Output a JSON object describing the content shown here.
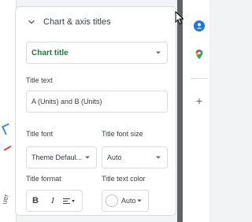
{
  "section": {
    "title": "Chart & axis titles"
  },
  "title_type": {
    "selected": "Chart title"
  },
  "title_text": {
    "label": "Title text",
    "value": "A (Units) and B (Units)"
  },
  "title_font": {
    "label": "Title font",
    "selected": "Theme Defaul..."
  },
  "title_font_size": {
    "label": "Title font size",
    "selected": "Auto"
  },
  "title_format": {
    "label": "Title format",
    "bold": "B",
    "italic": "I",
    "icons": [
      "bold-icon",
      "italic-icon",
      "align-icon"
    ]
  },
  "title_text_color": {
    "label": "Title text color",
    "selected": "Auto"
  },
  "left_clip": {
    "text": "uer"
  },
  "side_panel": {
    "icons": [
      "contacts-icon",
      "maps-icon",
      "add-icon"
    ],
    "add_glyph": "+"
  },
  "colors": {
    "accent_green": "#188038",
    "contacts_blue": "#1a73e8",
    "border": "#dadce0"
  }
}
